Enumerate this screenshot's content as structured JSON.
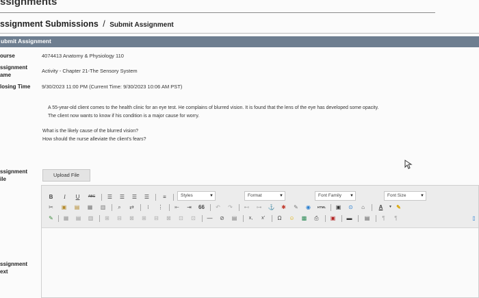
{
  "page": {
    "title": "ssignments",
    "breadcrumb_main": "ssignment Submissions",
    "breadcrumb_sep": "/",
    "breadcrumb_sub": "Submit Assignment"
  },
  "section": {
    "header": "ubmit Assignment"
  },
  "fields": {
    "course_label": "ourse",
    "course_value": "4074413 Anatomy & Physiology 110",
    "assignment_name_label_1": "ssignment",
    "assignment_name_label_2": "ame",
    "assignment_name_value": "Activity - Chapter 21-The Sensory System",
    "closing_time_label": "losing Time",
    "closing_time_value": "9/30/2023 11:00 PM (Current Time: 9/30/2023 10:06 AM PST)",
    "assignment_file_label_1": "ssignment",
    "assignment_file_label_2": "ile",
    "assignment_text_label_1": "ssignment",
    "assignment_text_label_2": "ext"
  },
  "prompt": {
    "line1": "A 55-year-old client comes to the health clinic for an eye test. He complains of blurred vision. It is found that the lens of the eye has developed some opacity.",
    "line2": "The client now wants to know if his condition is a major cause for worry.",
    "question1": "What is the likely cause of the blurred vision?",
    "question2": "How should the nurse alleviate the client's fears?"
  },
  "upload": {
    "label": "Upload File"
  },
  "editor": {
    "styles_label": "Styles",
    "format_label": "Format",
    "font_family_label": "Font Family",
    "font_size_label": "Font Size",
    "bold_label": "B",
    "italic_label": "I",
    "underline_label": "U",
    "strike_label": "ABC",
    "subscript_label": "x,",
    "superscript_label": "x'",
    "omega_label": "Ω",
    "blockquote_label": "66",
    "html_label": "HTML",
    "text_color_label": "A"
  },
  "colors": {
    "section_bar": "#6e7e90",
    "accent_link": "#2a7fd0"
  }
}
